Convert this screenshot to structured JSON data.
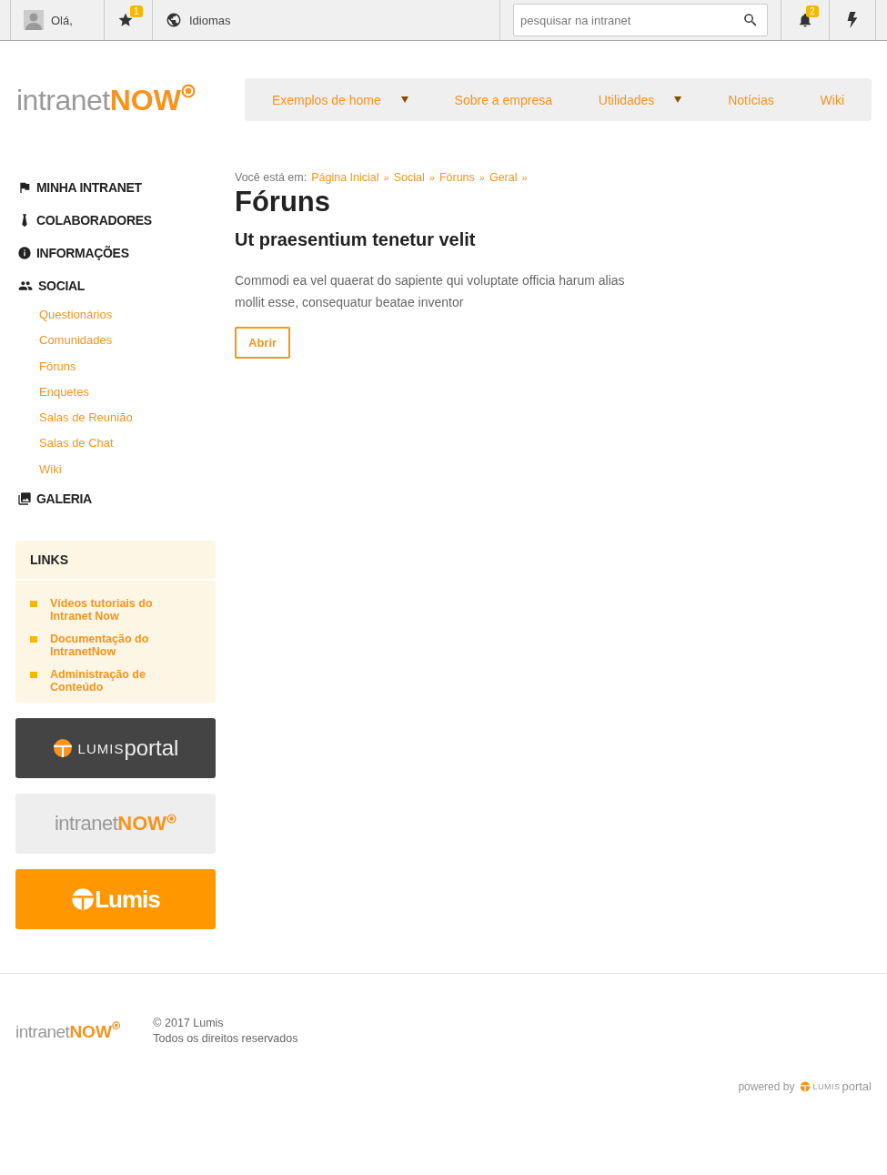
{
  "top_bar": {
    "greeting": "Olá,",
    "favorites_badge": "1",
    "languages": "Idiomas",
    "search": {
      "placeholder": "pesquisar na intranet"
    },
    "notifications_badge": "2"
  },
  "logo": {
    "light": "intranet",
    "bold": "NOW"
  },
  "nav": [
    {
      "label": "Exemplos de home",
      "dropdown": true
    },
    {
      "label": "Sobre a empresa",
      "dropdown": false
    },
    {
      "label": "Utilidades",
      "dropdown": true
    },
    {
      "label": "Notícias",
      "dropdown": false
    },
    {
      "label": "Wiki",
      "dropdown": false
    }
  ],
  "sidebar": [
    {
      "label": "MINHA INTRANET"
    },
    {
      "label": "COLABORADORES"
    },
    {
      "label": "INFORMAÇÕES"
    },
    {
      "label": "SOCIAL",
      "children": [
        {
          "label": "Questionários"
        },
        {
          "label": "Comunidades"
        },
        {
          "label": "Fóruns"
        },
        {
          "label": "Enquetes"
        },
        {
          "label": "Salas de Reunião"
        },
        {
          "label": "Salas de Chat"
        },
        {
          "label": "Wiki"
        }
      ]
    },
    {
      "label": "GALERIA"
    }
  ],
  "links": {
    "title": "LINKS",
    "items": [
      "Vídeos tutoriais do Intranet Now",
      "Documentação do IntranetNow",
      "Administração de Conteúdo"
    ]
  },
  "banners": [
    {
      "kind": "lumisportal",
      "light": "LUMIS",
      "bold": "portal"
    },
    {
      "kind": "intranetnow",
      "light": "intranet",
      "bold": "NOW"
    },
    {
      "kind": "lumis",
      "light": "Lumis"
    }
  ],
  "breadcrumb": {
    "prefix": "Você está em:",
    "separator": "»",
    "items": [
      "Página Inicial",
      "Social",
      "Fóruns",
      "Geral"
    ]
  },
  "title": "Fóruns",
  "subtitle": "Ut praesentium tenetur velit",
  "body": "Commodi ea vel quaerat do sapiente qui voluptate officia harum alias mollit esse, consequatur beatae inventor",
  "button": "Abrir",
  "footer": {
    "logo": {
      "light": "intranet",
      "bold": "NOW"
    },
    "copyright": "© 2017 Lumis",
    "rights": "Todos os direitos reservados",
    "powered_by": "powered by",
    "brand": {
      "light": "LUMIS",
      "bold": "portal"
    }
  }
}
